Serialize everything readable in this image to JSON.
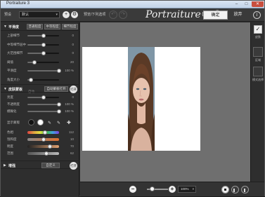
{
  "window": {
    "title": "Portraiture 3",
    "min": "–",
    "max": "□",
    "close": "✕"
  },
  "toolbar": {
    "preset_label": "预设",
    "preset_value": "默认",
    "add_label": "+",
    "settings_label": "⚙",
    "checkbox_text": "预览/下列选项",
    "undo_label": "↶",
    "redo_label": "↷",
    "brand": "Portraiture® 3",
    "ok_label": "确定",
    "cancel_label": "放弃",
    "info_label": "i"
  },
  "sections": {
    "detail": {
      "title": "平滑度",
      "buttons": [
        "普通程度",
        "中等程度",
        "细节程度"
      ],
      "sliders": [
        {
          "label": "上部细节",
          "value": "0",
          "fraction": 0.5
        },
        {
          "label": "中等细节层中",
          "value": "0",
          "fraction": 0.5
        },
        {
          "label": "大范围细节",
          "value": "0",
          "fraction": 0.5
        },
        {
          "label": "阈值",
          "value": "20",
          "fraction": 0.22
        },
        {
          "label": "平滑度",
          "value": "100 %",
          "fraction": 1.0
        },
        {
          "label": "角度大小",
          "value": "",
          "fraction": 0.1
        }
      ],
      "small_label": "自动"
    },
    "skin": {
      "title": "皮肤蒙板",
      "auto_button": "自动蒙板打开",
      "circle_button": "打开",
      "sliders": [
        {
          "label": "亮度",
          "value": "0",
          "fraction": 0.5
        },
        {
          "label": "不透明度",
          "value": "100 %",
          "fraction": 1.0
        },
        {
          "label": "模糊化",
          "value": "100 %",
          "fraction": 1.0
        }
      ],
      "color_label": "显示蒙版",
      "hue_sliders": [
        {
          "label": "色相",
          "value": "112",
          "fraction": 0.55
        },
        {
          "label": "饱和度",
          "value": "10",
          "fraction": 0.5
        },
        {
          "label": "明度",
          "value": "70",
          "fraction": 0.7
        },
        {
          "label": "范围",
          "value": "62",
          "fraction": 0.6
        }
      ]
    },
    "enhance": {
      "title": "增强",
      "preset": "自定义",
      "circle_button": "打开"
    }
  },
  "right_strip": {
    "check1": "✓",
    "label1": "皮肤",
    "label2": "区域",
    "label3": "模式选择"
  },
  "bottom": {
    "minus": "−",
    "plus": "+",
    "zoom": "100%"
  },
  "colors": {
    "accent": "#ffffff",
    "panel": "#2e2e2e",
    "canvas_bg": "#6f6f6f"
  }
}
